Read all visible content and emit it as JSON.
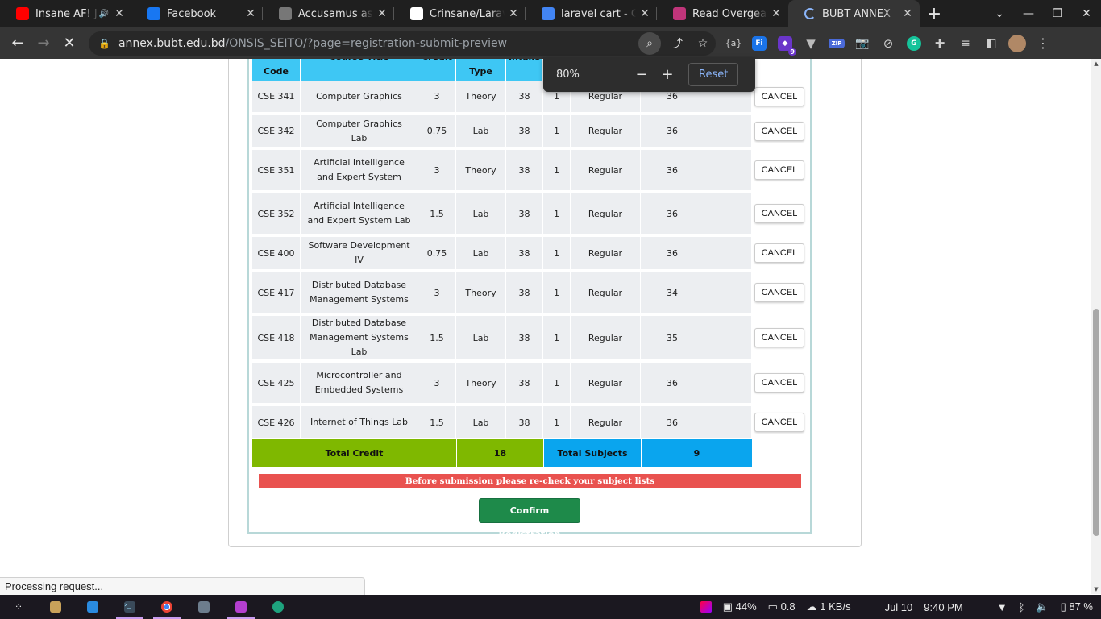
{
  "tabs": [
    {
      "title": "Insane AF! J",
      "favicon": "youtube-icon",
      "color": "#ff0000",
      "audio": true
    },
    {
      "title": "Facebook",
      "favicon": "facebook-icon",
      "color": "#1877f2"
    },
    {
      "title": "Accusamus ass",
      "favicon": "globe-icon",
      "color": "#777777"
    },
    {
      "title": "Crinsane/Larave",
      "favicon": "github-icon",
      "color": "#ffffff"
    },
    {
      "title": "laravel cart - Go",
      "favicon": "google-icon",
      "color": "#4285f4"
    },
    {
      "title": "Read Overgeare",
      "favicon": "reader-icon",
      "color": "#c0357a"
    },
    {
      "title": "BUBT ANNEX",
      "favicon": "loading-spinner-icon",
      "color": "#8ab4f8",
      "active": true
    }
  ],
  "address": {
    "domain": "annex.bubt.edu.bd",
    "path": "/ONSIS_SEITO/?page=registration-submit-preview"
  },
  "zoom": {
    "percent": "80%",
    "reset_label": "Reset",
    "minus": "−",
    "plus": "+"
  },
  "table": {
    "headers": [
      "Code",
      "Course Title",
      "Credit",
      "Type",
      "Intake"
    ],
    "cancel_label": "CANCEL",
    "rows": [
      {
        "code": "CSE 341",
        "title": "Computer Graphics",
        "credit": "3",
        "type": "Theory",
        "intake": "38",
        "sec": "1",
        "status": "Regular",
        "seats": "36"
      },
      {
        "code": "CSE 342",
        "title": "Computer Graphics Lab",
        "credit": "0.75",
        "type": "Lab",
        "intake": "38",
        "sec": "1",
        "status": "Regular",
        "seats": "36"
      },
      {
        "code": "CSE 351",
        "title": "Artificial Intelligence and Expert System",
        "credit": "3",
        "type": "Theory",
        "intake": "38",
        "sec": "1",
        "status": "Regular",
        "seats": "36"
      },
      {
        "code": "CSE 352",
        "title": "Artificial Intelligence and Expert System Lab",
        "credit": "1.5",
        "type": "Lab",
        "intake": "38",
        "sec": "1",
        "status": "Regular",
        "seats": "36"
      },
      {
        "code": "CSE 400",
        "title": "Software Development IV",
        "credit": "0.75",
        "type": "Lab",
        "intake": "38",
        "sec": "1",
        "status": "Regular",
        "seats": "36"
      },
      {
        "code": "CSE 417",
        "title": "Distributed Database Management Systems",
        "credit": "3",
        "type": "Theory",
        "intake": "38",
        "sec": "1",
        "status": "Regular",
        "seats": "34"
      },
      {
        "code": "CSE 418",
        "title": "Distributed Database Management Systems Lab",
        "credit": "1.5",
        "type": "Lab",
        "intake": "38",
        "sec": "1",
        "status": "Regular",
        "seats": "35"
      },
      {
        "code": "CSE 425",
        "title": "Microcontroller and Embedded Systems",
        "credit": "3",
        "type": "Theory",
        "intake": "38",
        "sec": "1",
        "status": "Regular",
        "seats": "36"
      },
      {
        "code": "CSE 426",
        "title": "Internet of Things Lab",
        "credit": "1.5",
        "type": "Lab",
        "intake": "38",
        "sec": "1",
        "status": "Regular",
        "seats": "36"
      }
    ]
  },
  "totals": {
    "credit_label": "Total Credit",
    "credit_value": "18",
    "subjects_label": "Total Subjects",
    "subjects_value": "9"
  },
  "warning": "Before submission please re-check your subject lists",
  "confirm_label": "Confirm Registration",
  "status_text": "Processing request...",
  "taskbar": {
    "battery_saver": "44%",
    "load": "0.8",
    "network": "1 KB/s",
    "date": "Jul 10",
    "time": "9:40 PM",
    "battery": "87 %"
  },
  "extensions_badge": "9",
  "colors": {
    "header_cyan": "#3ec7f4",
    "total_green": "#7fb800",
    "total_blue": "#0aa5ee",
    "warning_red": "#e9524f",
    "confirm_green": "#1e8a4a"
  }
}
